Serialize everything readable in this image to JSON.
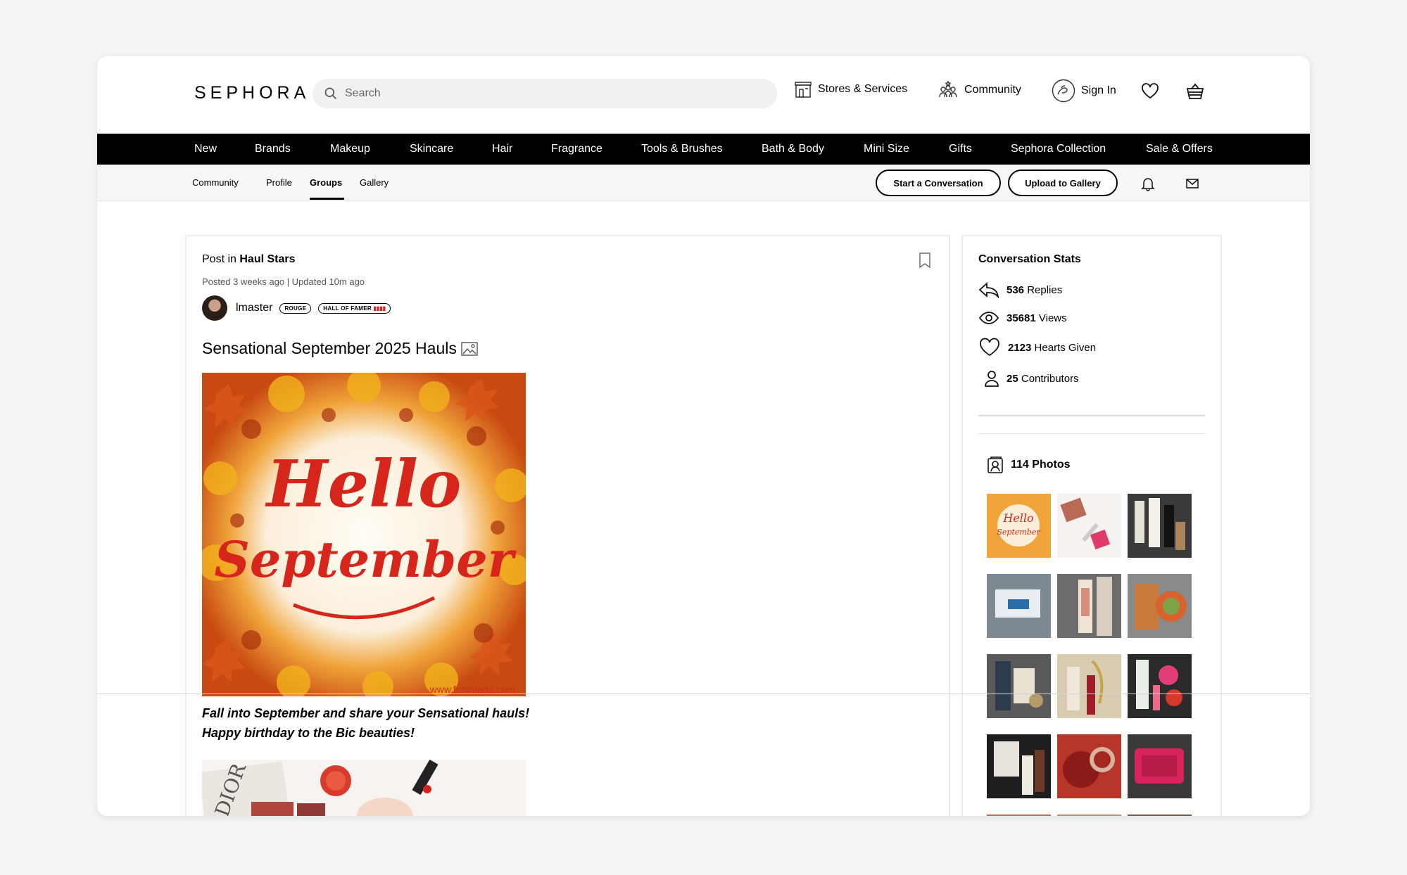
{
  "header": {
    "logo": "SEPHORA",
    "search_placeholder": "Search",
    "stores_label": "Stores & Services",
    "community_label": "Community",
    "signin_label": "Sign In",
    "icons": [
      "search-icon",
      "store-icon",
      "community-icon",
      "account-icon",
      "heart-icon",
      "basket-icon"
    ]
  },
  "nav": {
    "items": [
      "New",
      "Brands",
      "Makeup",
      "Skincare",
      "Hair",
      "Fragrance",
      "Tools & Brushes",
      "Bath & Body",
      "Mini Size",
      "Gifts",
      "Sephora Collection",
      "Sale & Offers"
    ]
  },
  "subnav": {
    "items": [
      "Community",
      "Profile",
      "Groups",
      "Gallery"
    ],
    "active": "Groups",
    "start_conversation": "Start a Conversation",
    "upload_gallery": "Upload to Gallery"
  },
  "post": {
    "post_in_prefix": "Post in",
    "group": "Haul Stars",
    "meta": "Posted 3 weeks ago  |  Updated 10m ago",
    "author": "lmaster",
    "badge_rouge": "ROUGE",
    "badge_hall": "HALL OF FAMER",
    "title": "Sensational September 2025 Hauls",
    "hero_text_1": "Hello",
    "hero_text_2": "September",
    "hero_watermark": "www.funimada.com",
    "body_line_1": "Fall into September and share your Sensational hauls!",
    "body_line_2": "Happy birthday to the Bic beauties!",
    "second_img_text": "DIOR"
  },
  "stats": {
    "title": "Conversation Stats",
    "replies_count": "536",
    "replies_label": "Replies",
    "views_count": "35681",
    "views_label": "Views",
    "hearts_count": "2123",
    "hearts_label": "Hearts Given",
    "contributors_count": "25",
    "contributors_label": "Contributors",
    "photos_count": "114",
    "photos_label": "Photos",
    "thumb_text_1": "Hello",
    "thumb_text_2": "September"
  },
  "colors": {
    "nav_bg": "#000000",
    "subnav_bg": "#f6f6f6",
    "accent_red": "#d6261c"
  }
}
